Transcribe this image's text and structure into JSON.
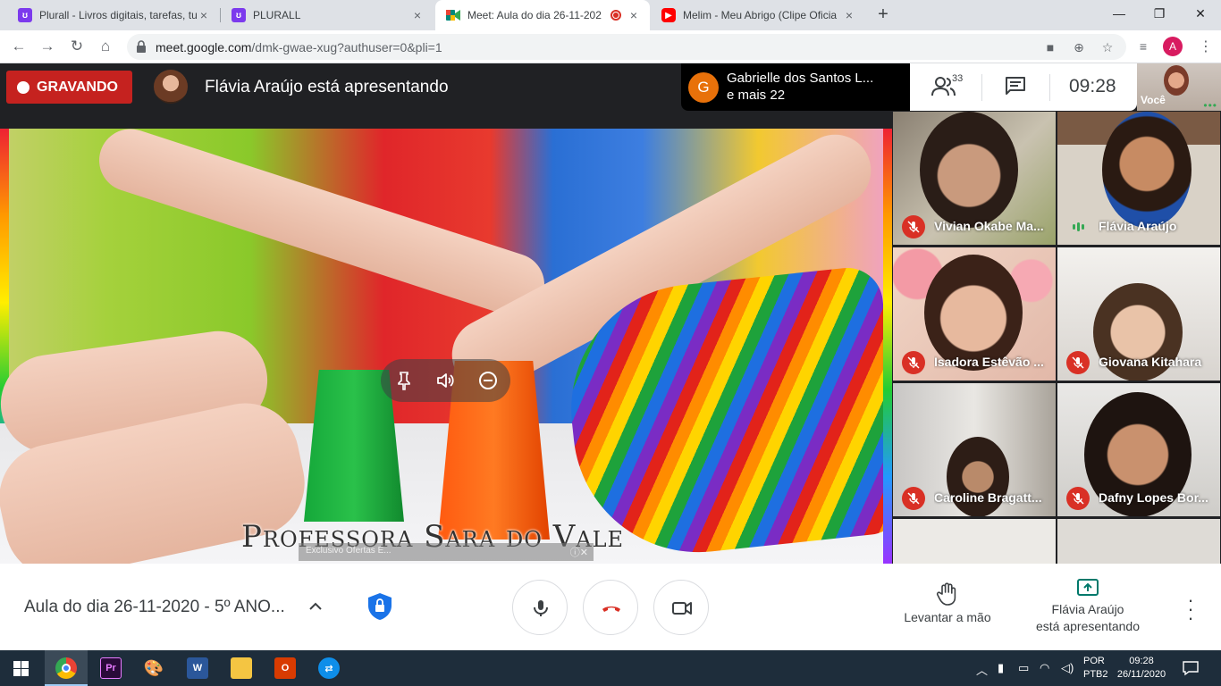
{
  "browser": {
    "tabs": [
      {
        "title": "Plurall - Livros digitais, tarefas, tu",
        "favicon_color": "#7c3aed"
      },
      {
        "title": "PLURALL",
        "favicon_color": "#7c3aed"
      },
      {
        "title": "Meet: Aula do dia 26-11-202",
        "favicon_color": "#00897b",
        "active": true,
        "recording": true
      },
      {
        "title": "Melim - Meu Abrigo (Clipe Oficia",
        "favicon_color": "#ff0000"
      }
    ],
    "close_glyph": "×",
    "new_tab_glyph": "+",
    "url_host": "meet.google.com",
    "url_path": "/dmk-gwae-xug?authuser=0&pli=1",
    "profile_initial": "A"
  },
  "meet": {
    "recording_label": "GRAVANDO",
    "presenting_text": "Flávia Araújo está apresentando",
    "chat_chip": {
      "initial": "G",
      "line1": "Gabrielle dos Santos L...",
      "line2": "e mais 22"
    },
    "participants_count": "33",
    "clock": "09:28",
    "self_label": "Você",
    "watermark": "Professora Sara do Vale",
    "yt_overlay": "Exclusivo Ofertas E...",
    "participants": [
      {
        "name": "Vivian Okabe Ma...",
        "muted": true
      },
      {
        "name": "Flávia Araújo",
        "muted": false
      },
      {
        "name": "Isadora Estêvão ...",
        "muted": true
      },
      {
        "name": "Giovana Kitahara",
        "muted": true
      },
      {
        "name": "Caroline Bragatt...",
        "muted": true
      },
      {
        "name": "Dafny Lopes Bor...",
        "muted": true
      }
    ],
    "meeting_title": "Aula do dia 26-11-2020 - 5º ANO...",
    "raise_hand_label": "Levantar a mão",
    "presenting_line1": "Flávia Araújo",
    "presenting_line2": "está apresentando",
    "colors": {
      "recording": "#c5221f",
      "accent": "#1a73e8",
      "muted": "#d93025",
      "presenting": "#00796b"
    }
  },
  "taskbar": {
    "apps": [
      "windows-start",
      "chrome",
      "premiere",
      "paint",
      "word",
      "explorer",
      "office",
      "teamviewer"
    ],
    "lang_line1": "POR",
    "lang_line2": "PTB2",
    "time": "09:28",
    "date": "26/11/2020"
  }
}
